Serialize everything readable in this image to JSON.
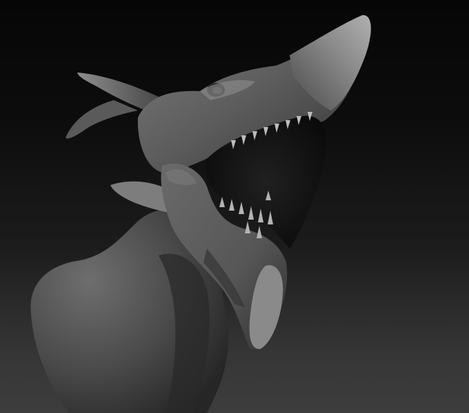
{
  "scene": {
    "subject": "creature-head-sculpt",
    "colors": {
      "background_top": "#060606",
      "background_bottom": "#3d3d3d",
      "clay_light": "#8a8a8a",
      "clay_mid": "#5e5e5e",
      "clay_dark": "#2b2b2b",
      "mouth_interior": "#151515",
      "teeth": "#b9b9b9"
    }
  }
}
